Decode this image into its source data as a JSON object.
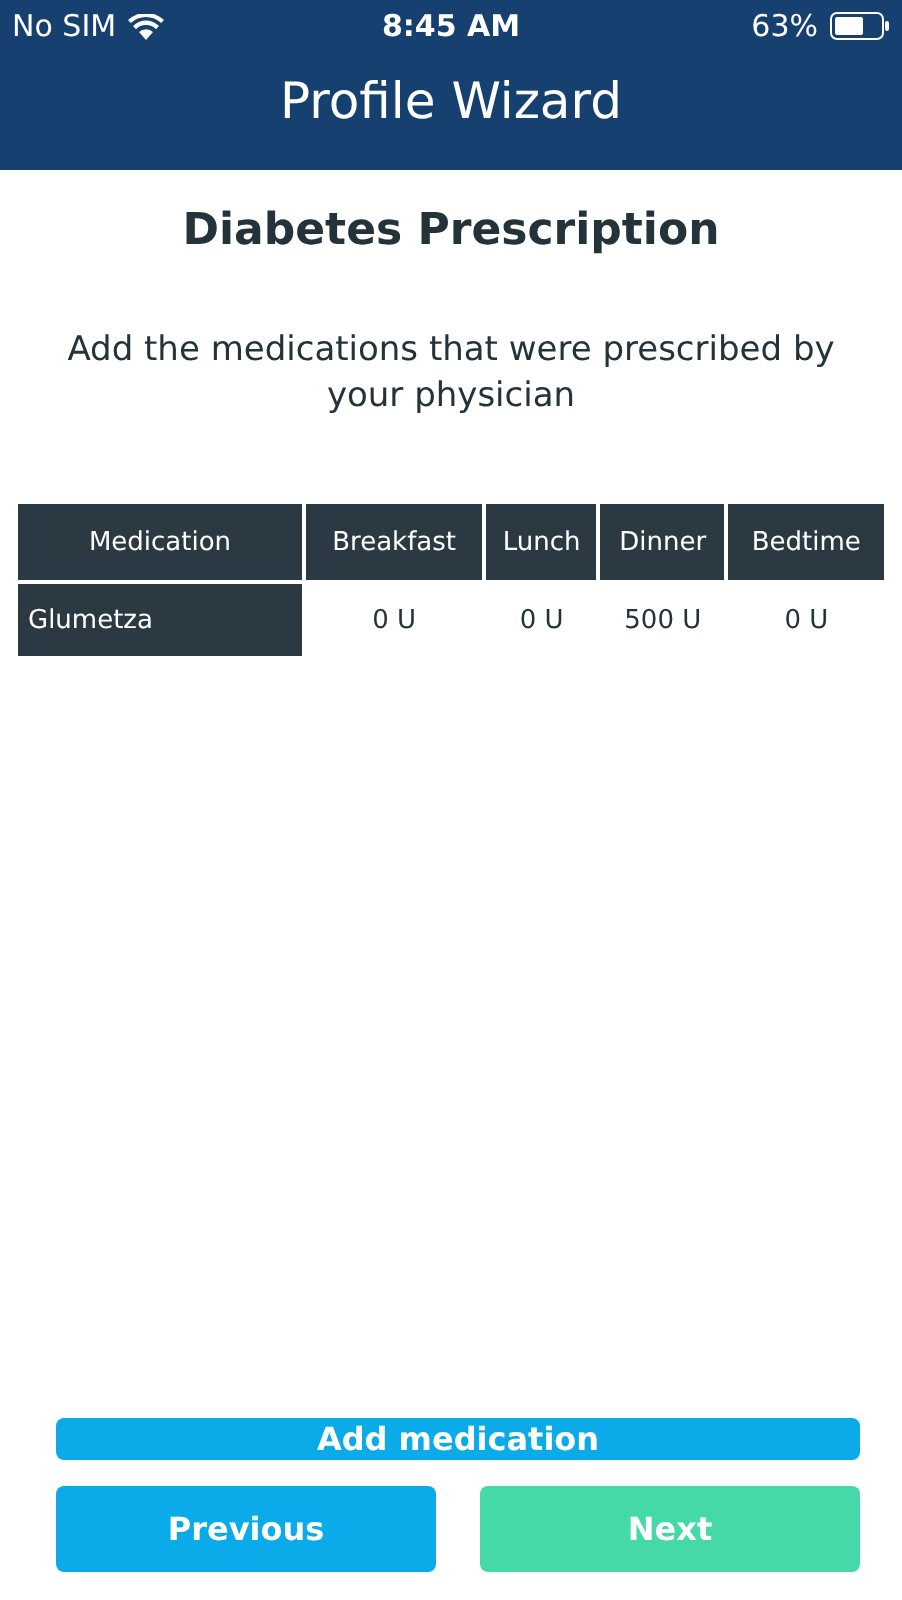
{
  "status_bar": {
    "carrier": "No SIM",
    "time": "8:45 AM",
    "battery": "63%"
  },
  "header": {
    "title": "Profile Wizard"
  },
  "heading": "Diabetes Prescription",
  "instructions": "Add the medications that were prescribed by your physician",
  "table": {
    "columns": [
      "Medication",
      "Breakfast",
      "Lunch",
      "Dinner",
      "Bedtime"
    ],
    "rows": [
      [
        "Glumetza",
        "0 U",
        "0 U",
        "500 U",
        "0 U"
      ]
    ]
  },
  "buttons": [
    {
      "label": "Add medication",
      "kind": "wide"
    },
    {
      "label": "Previous",
      "kind": "half"
    },
    {
      "label": "Next",
      "kind": "next"
    }
  ]
}
